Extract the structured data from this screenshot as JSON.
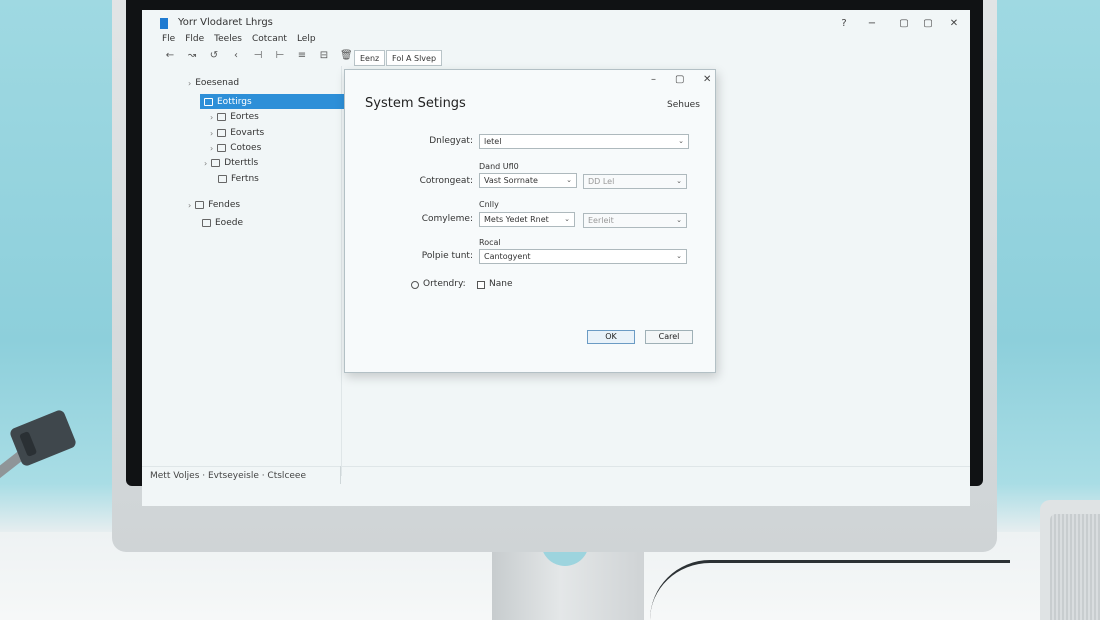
{
  "app": {
    "title": "Yorr Vlodaret Lhrgs",
    "window_controls": [
      "?",
      "−",
      "▢",
      "▢",
      "✕"
    ]
  },
  "menu": [
    "Fle",
    "Flde",
    "Teeles",
    "Cotcant",
    "Lelp"
  ],
  "toolbar_icons": [
    "back-icon",
    "forward-icon",
    "refresh-icon",
    "undo-icon",
    "cut-icon",
    "copy-icon",
    "paste-icon",
    "save-icon",
    "delete-icon",
    "document-icon"
  ],
  "toolbar_glyphs": [
    "←",
    "↝",
    "↺",
    "‹",
    "⊣",
    "⊢",
    "≡",
    "⊟",
    "🗑",
    "⊡"
  ],
  "tabs": [
    "Eenz",
    "Fol A Slvep"
  ],
  "sidebar": {
    "items": [
      {
        "label": "Eoesenad",
        "caret": "›"
      },
      {
        "label": "Eottirgs",
        "caret": ""
      },
      {
        "label": "Eortes",
        "caret": "›"
      },
      {
        "label": "Eovarts",
        "caret": "›"
      },
      {
        "label": "Cotoes",
        "caret": "›"
      },
      {
        "label": "Dterttls",
        "caret": "›"
      },
      {
        "label": "Fertns",
        "caret": ""
      },
      {
        "label": "Fendes",
        "caret": "›"
      },
      {
        "label": "Eoede",
        "caret": ""
      }
    ]
  },
  "status_bar": "Mett Voljes · Evtseyeisle · Ctslceee",
  "dialog": {
    "title": "System Setings",
    "right_label": "Sehues",
    "ok_label": "OK",
    "cancel_label": "Carel",
    "fields": {
      "category_label": "Dnlegyat:",
      "category_value": "letel",
      "caption1": "Dand Ufl0",
      "components1_label": "Cotrongeat:",
      "components1_value": "Vast Sorrnate",
      "components1_extra": "DD Lel",
      "caption2": "Cnlly",
      "components2_label": "Comyleme:",
      "components2_value": "Mets Yedet Rnet",
      "components2_extra": "Eerleit",
      "caption3": "Rocal",
      "polyhe_label": "Polpie tunt:",
      "polyhe_value": "Cantogyent",
      "radio_label": "Ortendry:",
      "check_label": "Nane"
    }
  }
}
